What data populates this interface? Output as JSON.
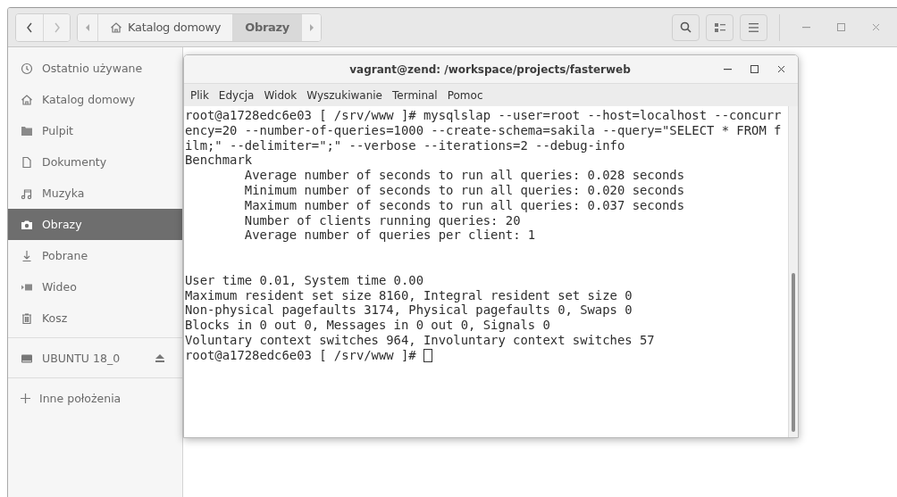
{
  "header": {
    "path": [
      {
        "label": "Katalog domowy",
        "selected": false
      },
      {
        "label": "Obrazy",
        "selected": true
      }
    ]
  },
  "sidebar": {
    "places": [
      {
        "label": "Ostatnio używane",
        "selected": false
      },
      {
        "label": "Katalog domowy",
        "selected": false
      },
      {
        "label": "Pulpit",
        "selected": false
      },
      {
        "label": "Dokumenty",
        "selected": false
      },
      {
        "label": "Muzyka",
        "selected": false
      },
      {
        "label": "Obrazy",
        "selected": true
      },
      {
        "label": "Pobrane",
        "selected": false
      },
      {
        "label": "Wideo",
        "selected": false
      },
      {
        "label": "Kosz",
        "selected": false
      }
    ],
    "devices": [
      {
        "label": "UBUNTU 18_0"
      }
    ],
    "other": {
      "label": "Inne położenia"
    }
  },
  "terminal": {
    "title": "vagrant@zend: /workspace/projects/fasterweb",
    "menu": [
      "Plik",
      "Edycja",
      "Widok",
      "Wyszukiwanie",
      "Terminal",
      "Pomoc"
    ],
    "blocks": [
      {
        "lines": [
          {
            "text": "root@a1728edc6e03 [ /srv/www ]# mysqlslap --user=root --host=localhost --concurr",
            "indented": false
          },
          {
            "text": "ency=20 --number-of-queries=1000 --create-schema=sakila --query=\"SELECT * FROM f",
            "indented": false
          },
          {
            "text": "ilm;\" --delimiter=\";\" --verbose --iterations=2 --debug-info",
            "indented": false
          },
          {
            "text": "Benchmark",
            "indented": false
          },
          {
            "text": "Average number of seconds to run all queries: 0.028 seconds",
            "indented": true
          },
          {
            "text": "Minimum number of seconds to run all queries: 0.020 seconds",
            "indented": true
          },
          {
            "text": "Maximum number of seconds to run all queries: 0.037 seconds",
            "indented": true
          },
          {
            "text": "Number of clients running queries: 20",
            "indented": true
          },
          {
            "text": "Average number of queries per client: 1",
            "indented": true
          }
        ]
      },
      {
        "lines": [
          {
            "text": "User time 0.01, System time 0.00",
            "indented": false
          },
          {
            "text": "Maximum resident set size 8160, Integral resident set size 0",
            "indented": false
          },
          {
            "text": "Non-physical pagefaults 3174, Physical pagefaults 0, Swaps 0",
            "indented": false
          },
          {
            "text": "Blocks in 0 out 0, Messages in 0 out 0, Signals 0",
            "indented": false
          },
          {
            "text": "Voluntary context switches 964, Involuntary context switches 57",
            "indented": false
          }
        ]
      }
    ],
    "prompt": {
      "text": "root@a1728edc6e03 [ /srv/www ]#",
      "cursor": true
    }
  }
}
